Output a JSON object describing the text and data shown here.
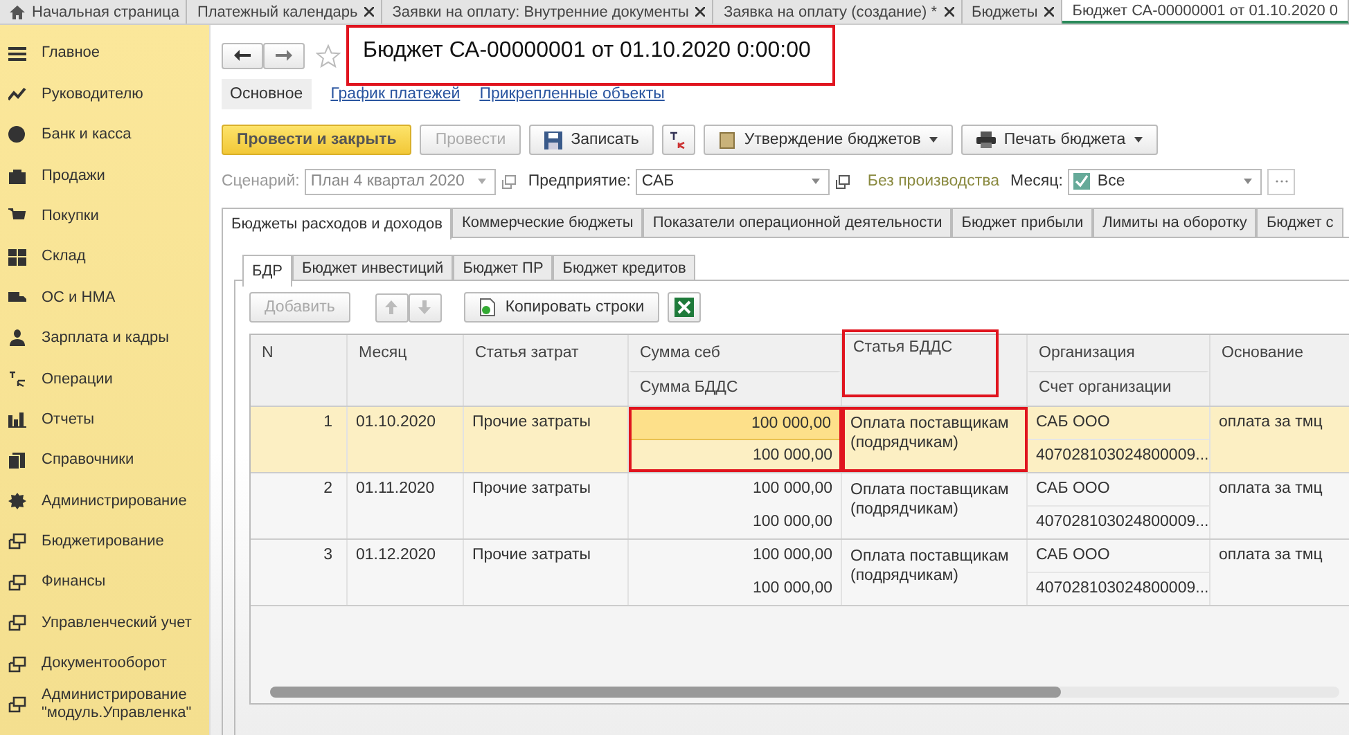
{
  "top_tabs": [
    {
      "label": "Начальная страница",
      "kind": "home",
      "selected": false
    },
    {
      "label": "Платежный календарь",
      "kind": "doc",
      "selected": false
    },
    {
      "label": "Заявки на оплату: Внутренние документы",
      "kind": "doc",
      "selected": false
    },
    {
      "label": "Заявка на оплату (создание) *",
      "kind": "doc",
      "selected": false
    },
    {
      "label": "Бюджеты",
      "kind": "doc",
      "selected": false
    },
    {
      "label": "Бюджет СА-00000001 от 01.10.2020 0",
      "kind": "doc",
      "selected": true
    }
  ],
  "sidebar": {
    "items": [
      {
        "label": "Главное"
      },
      {
        "label": "Руководителю"
      },
      {
        "label": "Банк и касса"
      },
      {
        "label": "Продажи"
      },
      {
        "label": "Покупки"
      },
      {
        "label": "Склад"
      },
      {
        "label": "ОС и НМА"
      },
      {
        "label": "Зарплата и кадры"
      },
      {
        "label": "Операции"
      },
      {
        "label": "Отчеты"
      },
      {
        "label": "Справочники"
      },
      {
        "label": "Администрирование"
      },
      {
        "label": "Бюджетирование"
      },
      {
        "label": "Финансы"
      },
      {
        "label": "Управленческий учет"
      },
      {
        "label": "Документооборот"
      },
      {
        "label": "Администрирование \"модуль.Управленка\""
      }
    ]
  },
  "document": {
    "title": "Бюджет СА-00000001 от 01.10.2020 0:00:00",
    "title_highlighted": true,
    "sections": [
      {
        "label": "Основное",
        "selected": true
      },
      {
        "label": "График платежей",
        "selected": false
      },
      {
        "label": "Прикрепленные объекты",
        "selected": false
      }
    ],
    "commands": [
      {
        "label": "Провести и закрыть",
        "kind": "primary"
      },
      {
        "label": "Провести",
        "kind": "disabled"
      },
      {
        "label": "Записать",
        "kind": "save"
      },
      {
        "kind": "dtkt"
      },
      {
        "label": "Утверждение бюджетов",
        "kind": "menu-folder"
      },
      {
        "label": "Печать бюджета",
        "kind": "menu-print"
      }
    ],
    "filters": {
      "scenario_label": "Сценарий:",
      "scenario_value": "План 4 квартал 2020",
      "company_label": "Предприятие:",
      "company_value": "САБ",
      "production_note": "Без производства",
      "month_label": "Месяц:",
      "month_value": "Все"
    },
    "budget_tabs": [
      {
        "label": "Бюджеты расходов и доходов",
        "selected": true
      },
      {
        "label": "Коммерческие бюджеты",
        "selected": false
      },
      {
        "label": "Показатели операционной деятельности",
        "selected": false
      },
      {
        "label": "Бюджет прибыли",
        "selected": false
      },
      {
        "label": "Лимиты на оборотку",
        "selected": false
      },
      {
        "label": "Бюджет с",
        "selected": false
      }
    ],
    "sub_tabs": [
      {
        "label": "БДР",
        "selected": true
      },
      {
        "label": "Бюджет инвестиций",
        "selected": false
      },
      {
        "label": "Бюджет ПР",
        "selected": false
      },
      {
        "label": "Бюджет кредитов",
        "selected": false
      }
    ],
    "table_commands": {
      "add": "Добавить",
      "copy": "Копировать строки"
    },
    "table": {
      "columns": [
        {
          "top": "N",
          "highlighted": false
        },
        {
          "top": "Месяц",
          "highlighted": false
        },
        {
          "top": "Статья затрат",
          "highlighted": false
        },
        {
          "top": "Сумма себ",
          "bottom": "Сумма БДДС",
          "highlighted": false
        },
        {
          "top": "Статья БДДС",
          "highlighted": true
        },
        {
          "top": "Организация",
          "bottom": "Счет организации",
          "highlighted": false
        },
        {
          "top": "Основание",
          "highlighted": false
        }
      ],
      "rows": [
        {
          "n": "1",
          "month": "01.10.2020",
          "cost_item": "Прочие затраты",
          "sum_cost": "100 000,00",
          "sum_bdds": "100 000,00",
          "bdds_item": "Оплата поставщикам (подрядчикам)",
          "organization": "САБ ООО",
          "account": "407028103024800009...",
          "basis": "оплата за тмц",
          "selected": true,
          "highlighted": true
        },
        {
          "n": "2",
          "month": "01.11.2020",
          "cost_item": "Прочие затраты",
          "sum_cost": "100 000,00",
          "sum_bdds": "100 000,00",
          "bdds_item": "Оплата поставщикам (подрядчикам)",
          "organization": "САБ ООО",
          "account": "407028103024800009...",
          "basis": "оплата за тмц",
          "selected": false,
          "highlighted": false
        },
        {
          "n": "3",
          "month": "01.12.2020",
          "cost_item": "Прочие затраты",
          "sum_cost": "100 000,00",
          "sum_bdds": "100 000,00",
          "bdds_item": "Оплата поставщикам (подрядчикам)",
          "organization": "САБ ООО",
          "account": "407028103024800009...",
          "basis": "оплата за тмц",
          "selected": false,
          "highlighted": false
        }
      ]
    }
  }
}
